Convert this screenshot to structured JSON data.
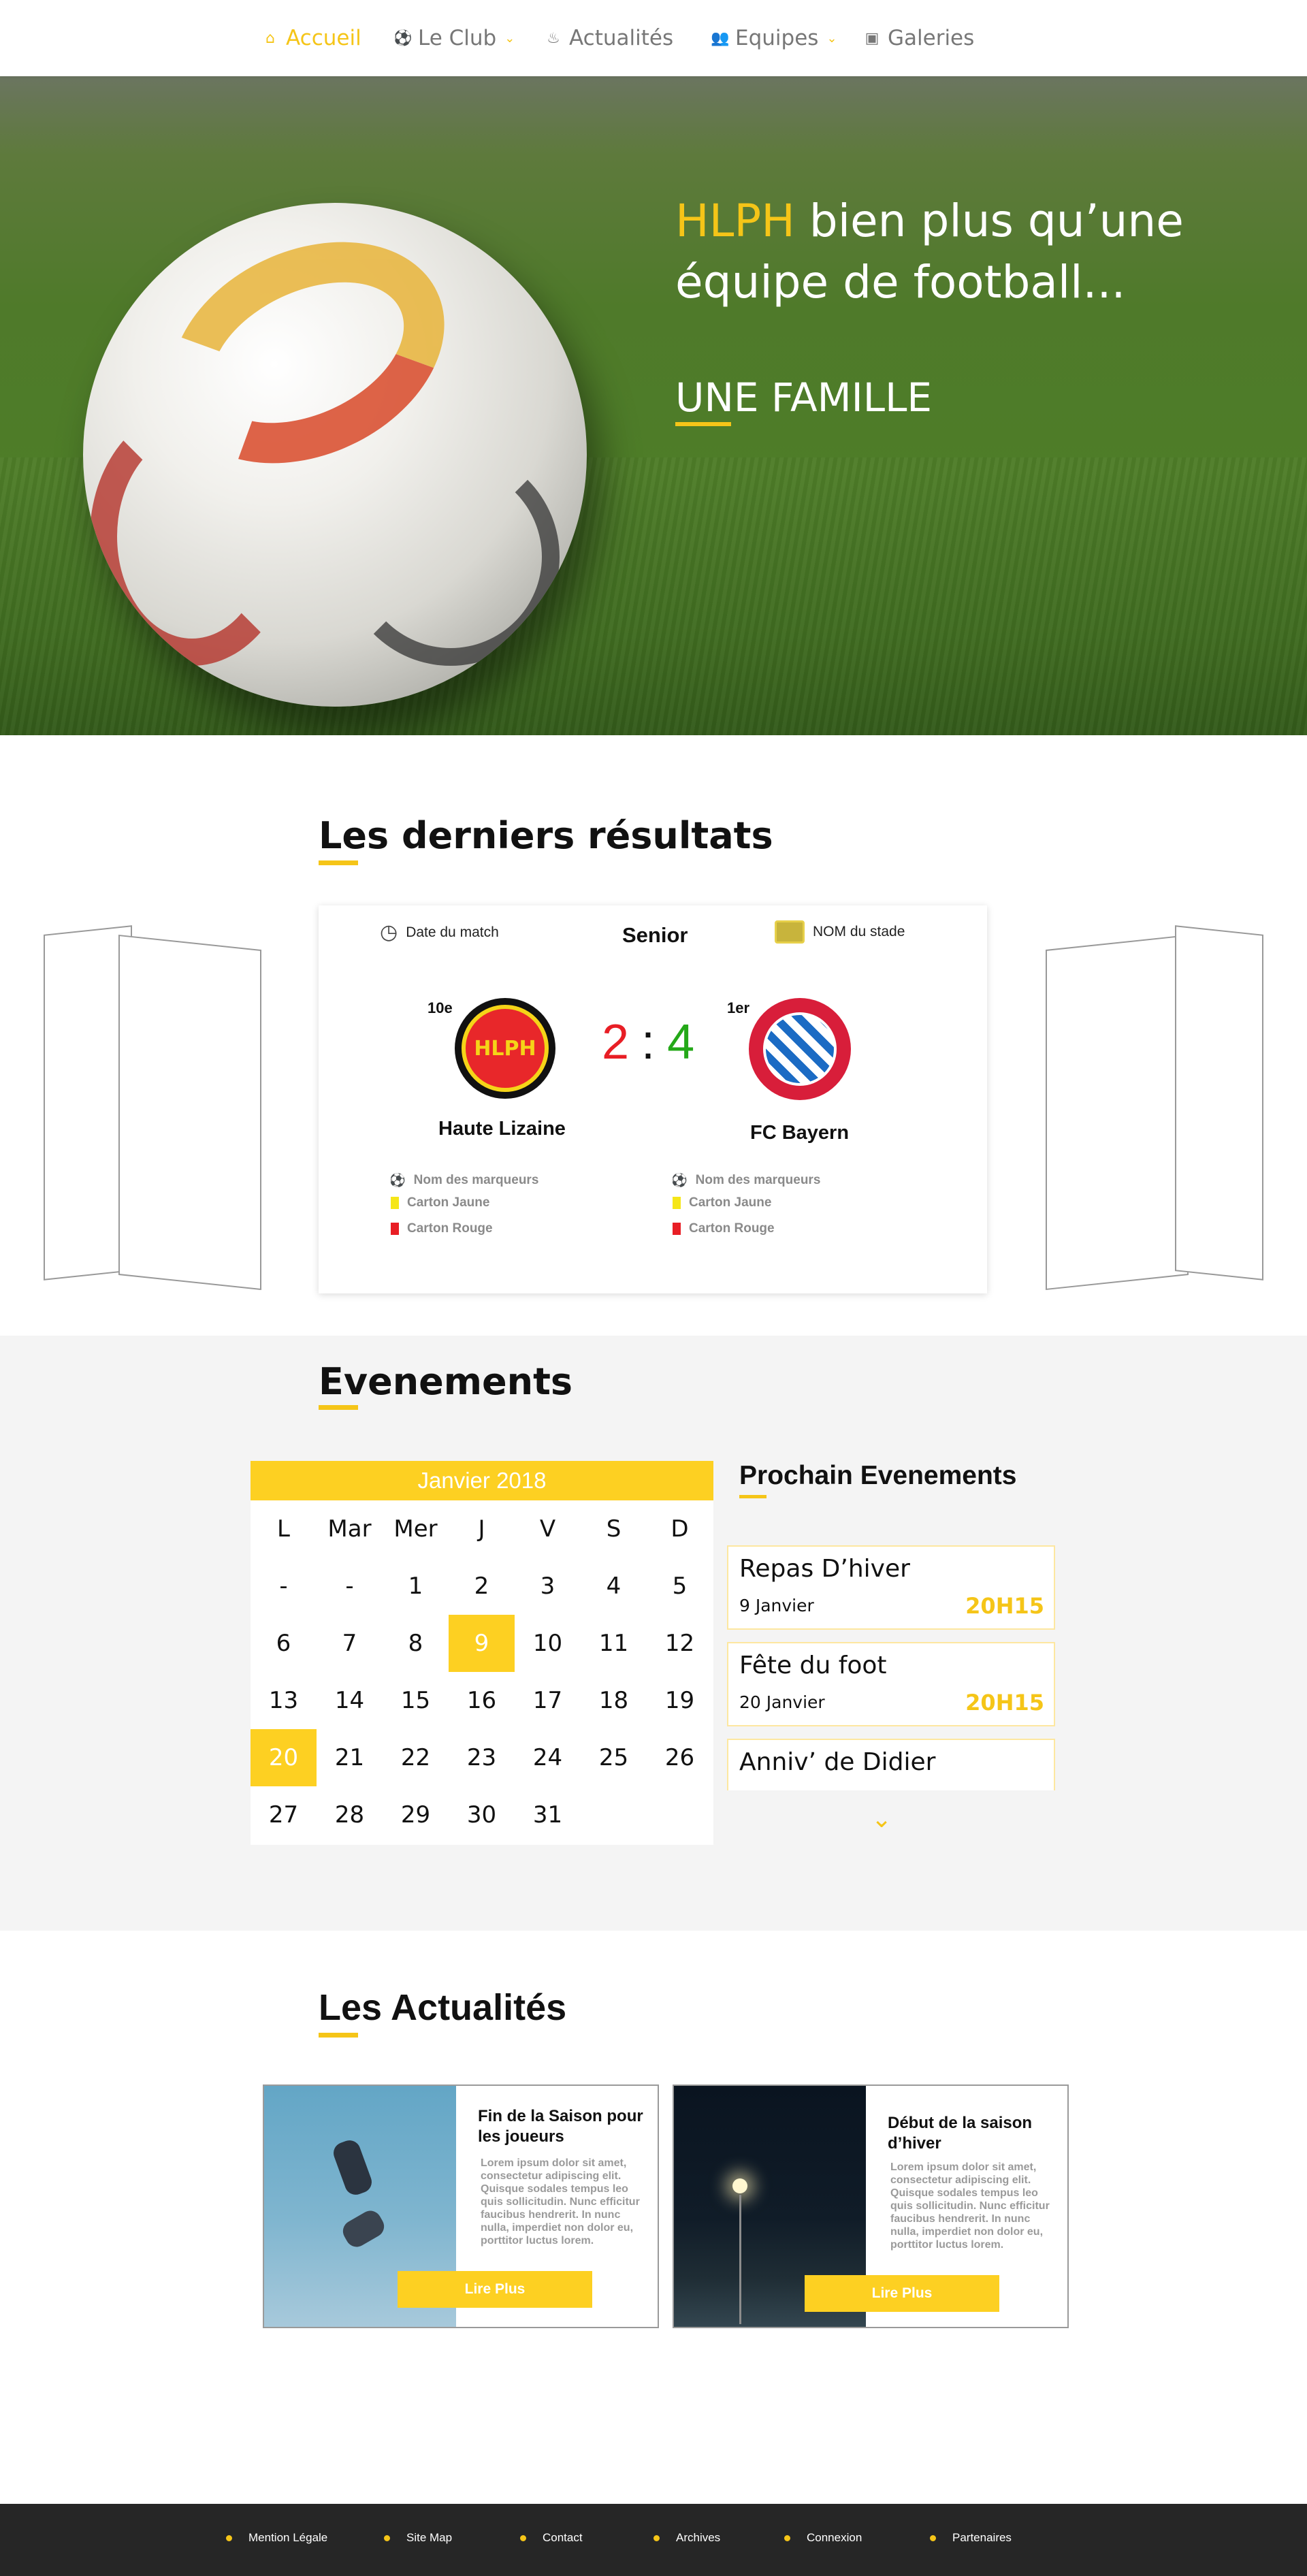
{
  "nav": {
    "items": [
      {
        "label": "Accueil",
        "icon": "home-icon",
        "active": true
      },
      {
        "label": "Le Club",
        "icon": "soccer-ball-icon",
        "dropdown": true
      },
      {
        "label": "Actualités",
        "icon": "flame-icon"
      },
      {
        "label": "Equipes",
        "icon": "people-icon",
        "dropdown": true
      },
      {
        "label": "Galeries",
        "icon": "gallery-icon"
      }
    ]
  },
  "hero": {
    "title_highlight": "HLPH",
    "title_rest": " bien plus qu’une équipe de football...",
    "subtitle": "UNE FAMILLE"
  },
  "results": {
    "title": "Les derniers résultats",
    "match_date_label": "Date du match",
    "category": "Senior",
    "stadium_label": "NOM du stade",
    "home": {
      "rank": "10e",
      "name": "Haute Lizaine",
      "logo_text": "HLPH"
    },
    "away": {
      "rank": "1er",
      "name": "FC Bayern"
    },
    "score_home": "2",
    "score_sep": ":",
    "score_away": "4",
    "events_home": [
      "Nom des marqueurs",
      "Carton Jaune",
      "Carton Rouge"
    ],
    "events_away": [
      "Nom des marqueurs",
      "Carton Jaune",
      "Carton Rouge"
    ]
  },
  "events": {
    "title": "Evenements",
    "calendar": {
      "month": "Janvier 2018",
      "weekdays": [
        "L",
        "Mar",
        "Mer",
        "J",
        "V",
        "S",
        "D"
      ],
      "weeks": [
        [
          "-",
          "-",
          "1",
          "2",
          "3",
          "4",
          "5"
        ],
        [
          "6",
          "7",
          "8",
          "9",
          "10",
          "11",
          "12"
        ],
        [
          "13",
          "14",
          "15",
          "16",
          "17",
          "18",
          "19"
        ],
        [
          "20",
          "21",
          "22",
          "23",
          "24",
          "25",
          "26"
        ],
        [
          "27",
          "28",
          "29",
          "30",
          "31",
          "",
          ""
        ]
      ],
      "highlighted": [
        "9",
        "20"
      ]
    },
    "upcoming_title": "Prochain Evenements",
    "upcoming": [
      {
        "name": "Repas D’hiver",
        "date": "9 Janvier",
        "time": "20H15"
      },
      {
        "name": "Fête du foot",
        "date": "20 Janvier",
        "time": "20H15"
      },
      {
        "name": "Anniv’ de Didier",
        "date": "",
        "time": ""
      }
    ]
  },
  "news": {
    "title": "Les Actualités",
    "articles": [
      {
        "title": "Fin de la Saison pour les joueurs",
        "body": "Lorem ipsum dolor sit amet, consectetur adipiscing elit. Quisque sodales tempus leo quis sollicitudin. Nunc efficitur faucibus hendrerit. In nunc nulla, imperdiet non dolor eu, porttitor luctus lorem.",
        "button": "Lire Plus"
      },
      {
        "title": "Début de la saison d’hiver",
        "body": "Lorem ipsum dolor sit amet, consectetur adipiscing elit. Quisque sodales tempus leo quis sollicitudin. Nunc efficitur faucibus hendrerit. In nunc nulla, imperdiet non dolor eu, porttitor luctus lorem.",
        "button": "Lire Plus"
      }
    ]
  },
  "footer": {
    "links": [
      "Mention Légale",
      "Site Map",
      "Contact",
      "Archives",
      "Connexion",
      "Partenaires"
    ]
  },
  "colors": {
    "accent": "#f5c518",
    "calendar_header": "#fdd022",
    "score_home": "#e81e25",
    "score_away": "#24a818",
    "footer_bg": "#262626",
    "events_bg": "#f4f4f4"
  }
}
